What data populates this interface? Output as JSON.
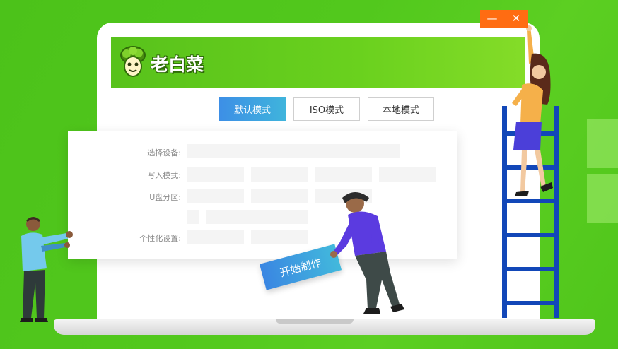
{
  "app": {
    "logo_text": "老白菜"
  },
  "window_controls": {
    "minimize": "—",
    "close": "✕",
    "color": "#ff6c12"
  },
  "tabs": [
    {
      "label": "默认模式",
      "active": true
    },
    {
      "label": "ISO模式",
      "active": false
    },
    {
      "label": "本地模式",
      "active": false
    }
  ],
  "form": {
    "select_device_label": "选择设备:",
    "write_mode_label": "写入模式:",
    "partition_label": "U盘分区:",
    "personalize_label": "个性化设置:"
  },
  "start_button": {
    "label": "开始制作"
  },
  "colors": {
    "background_green": "#52c81d",
    "accent_blue": "#3d8fe6",
    "header_green": "#6ad11e"
  },
  "icons": {
    "logo": "cabbage-mascot-icon",
    "minimize": "minimize-icon",
    "close": "close-icon"
  }
}
